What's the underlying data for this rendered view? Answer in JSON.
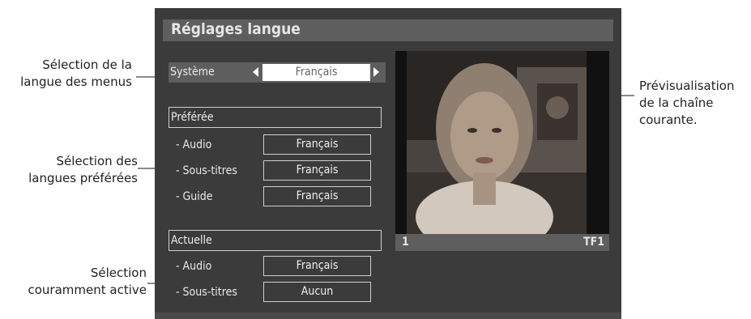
{
  "annotations": {
    "menu_language": "Sélection de la\nlangue des menus",
    "preferred": "Sélection des\nlangues préférées",
    "current": "Sélection\ncouramment active",
    "preview": "Prévisualisation\nde la chaîne\ncourante."
  },
  "screen": {
    "title": "Réglages langue",
    "system": {
      "label": "Système",
      "value": "Français"
    },
    "preferred": {
      "header": "Préférée",
      "rows": [
        {
          "label": "- Audio",
          "value": "Français"
        },
        {
          "label": "- Sous-titres",
          "value": "Français"
        },
        {
          "label": "- Guide",
          "value": "Français"
        }
      ]
    },
    "current": {
      "header": "Actuelle",
      "rows": [
        {
          "label": "- Audio",
          "value": "Français"
        },
        {
          "label": "- Sous-titres",
          "value": "Aucun"
        }
      ]
    },
    "channel": {
      "number": "1",
      "name": "TF1"
    }
  },
  "colors": {
    "screen_bg": "#3b3b3b",
    "bar": "#5e5e5e",
    "text": "#e9e9e9"
  }
}
